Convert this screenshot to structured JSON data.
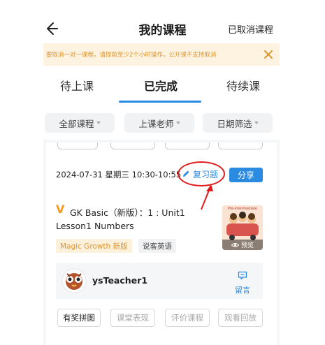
{
  "header": {
    "title": "我的课程",
    "cancelled_link": "已取消课程"
  },
  "notice": {
    "text": "要取消一对一课程，请提前至少2个小时操作，公开课不支持取消"
  },
  "tabs": [
    {
      "label": "待上课",
      "active": false
    },
    {
      "label": "已完成",
      "active": true
    },
    {
      "label": "待续课",
      "active": false
    }
  ],
  "filters": [
    {
      "label": "全部课程"
    },
    {
      "label": "上课老师"
    },
    {
      "label": "日期筛选"
    }
  ],
  "lesson": {
    "datetime": "2024-07-31 星期三 10:30-10:55",
    "review_label": "复习题",
    "share_label": "分享",
    "course_mark": "V",
    "course_name": "GK Basic（新版）：1 : Unit1",
    "lesson_name": "Lesson1 Numbers",
    "tags": [
      "Magic Growth 新版",
      "说客英语"
    ],
    "thumbnail": {
      "caption": "Pre-intermediate",
      "preview_label": "预览"
    },
    "teacher": {
      "name": "ysTeacher1",
      "message_label": "留言"
    },
    "actions": [
      {
        "label": "有奖拼图",
        "enabled": true
      },
      {
        "label": "课堂表现",
        "enabled": false
      },
      {
        "label": "评价课程",
        "enabled": false
      },
      {
        "label": "观看回放",
        "enabled": false
      }
    ]
  },
  "colors": {
    "accent_blue": "#2b8be0",
    "notice_bg": "#fdf3e0",
    "notice_text": "#e0962e",
    "annotation_red": "#e11b1b"
  },
  "icons": [
    "back-arrow-icon",
    "close-icon",
    "pencil-icon",
    "eye-icon",
    "message-icon",
    "chevron-down-icon"
  ]
}
